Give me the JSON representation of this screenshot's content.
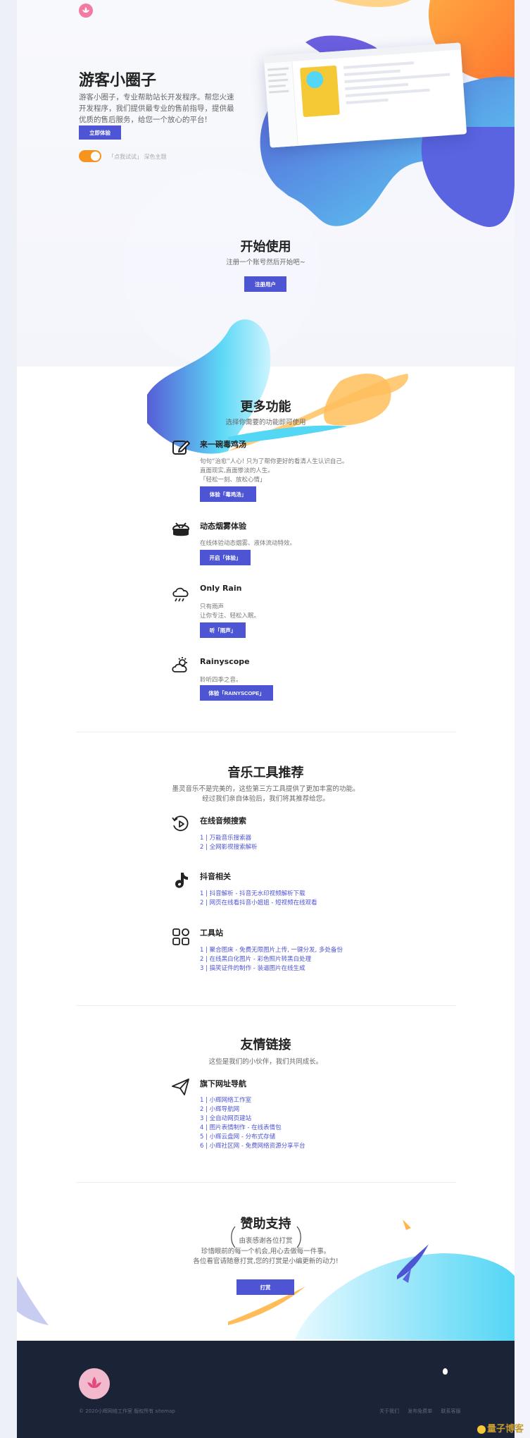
{
  "hero": {
    "title": "游客小圈子",
    "desc": "游客小圈子，专业帮助站长开发程序。帮您火速开发程序，我们提供最专业的售前指导，提供最优质的售后服务，给您一个放心的平台!",
    "cta_label": "立即体验",
    "theme_toggle": {
      "label": "「点我试试」",
      "state_label": "深色主题"
    }
  },
  "start": {
    "title": "开始使用",
    "subtitle": "注册一个账号然后开始吧~",
    "button_label": "注册用户"
  },
  "features": {
    "title": "更多功能",
    "subtitle": "选择你需要的功能即可使用",
    "items": [
      {
        "icon": "edit-icon",
        "title": "来一碗毒鸡汤",
        "desc": [
          "句句“治愈”人心! 只为了帮你更好的看清人生认识自己。",
          "直面现实,直面惨淡的人生。",
          "「轻松一刻、放松心情」"
        ],
        "button_label": "体验「毒鸡汤」"
      },
      {
        "icon": "drum-icon",
        "title": "动态烟雾体验",
        "desc": [
          "在线体验动态烟雾、液体流动特效。"
        ],
        "button_label": "开启「体验」"
      },
      {
        "icon": "rain-cloud-icon",
        "title": "Only Rain",
        "desc": [
          "只有雨声",
          "让你专注、轻松入眠。"
        ],
        "button_label": "听「雨声」"
      },
      {
        "icon": "cloud-sun-icon",
        "title": "Rainyscope",
        "desc": [
          "聆听四季之音。"
        ],
        "button_label": "体验「RAINYSCOPE」"
      }
    ]
  },
  "music": {
    "title": "音乐工具推荐",
    "subtitle_lines": [
      "墨灵音乐不是完美的，这些第三方工具提供了更加丰富的功能。",
      "经过我们亲自体验后，我们将其推荐给您。"
    ],
    "groups": [
      {
        "icon": "music-search-icon",
        "title": "在线音频搜索",
        "links": [
          "1 | 万能音乐搜索器",
          "2 | 全网影视搜索解析"
        ]
      },
      {
        "icon": "tiktok-icon",
        "title": "抖音相关",
        "links": [
          "1 | 抖音解析 - 抖音无水印视频解析下载",
          "2 | 网页在线看抖音小姐姐 - 短视频在线观看"
        ]
      },
      {
        "icon": "apps-icon",
        "title": "工具站",
        "links": [
          "1 | 聚合图床 - 免费无限图片上传, 一键分发, 多处备份",
          "2 | 在线黑白化图片 - 彩色照片转黑白处理",
          "3 | 搞笑证件的制作 - 装逼图片在线生成"
        ]
      }
    ]
  },
  "friends": {
    "title": "友情链接",
    "subtitle": "这些是我们的小伙伴，我们共同成长。",
    "groups": [
      {
        "icon": "paper-plane-icon",
        "title": "旗下网址导航",
        "links": [
          "1 | 小辉网络工作室",
          "2 | 小辉导航网",
          "3 | 全自动网页建站",
          "4 | 图片表情制作 - 在线表情包",
          "5 | 小辉云盘网 - 分布式存储",
          "6 | 小辉社区网 - 免费网络资源分享平台"
        ]
      }
    ]
  },
  "donate": {
    "title": "赞助支持",
    "note": "由衷感谢各位打赏",
    "lines": [
      "珍惜眼前的每一个机会,用心去做每一件事。",
      "各位看官请随意打赏,您的打赏是小编更新的动力!"
    ],
    "button_label": "打赏"
  },
  "footer": {
    "copyright": "© 2020小辉网络工作室 版权所有 sitemap",
    "links": [
      "关于我们",
      "发布免费单",
      "联系客服"
    ]
  },
  "watermark": "量子博客",
  "colors": {
    "accent": "#4d55d4",
    "toggle": "#f7941d",
    "footer_bg": "#1b2436",
    "cyan": "#54d6f5",
    "orange": "#ffb547"
  }
}
